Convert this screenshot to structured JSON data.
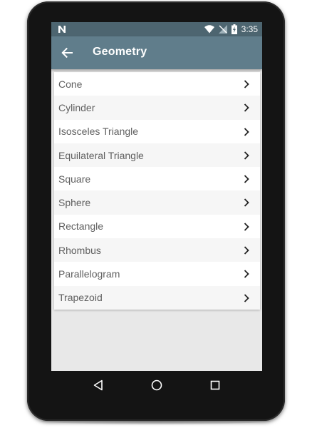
{
  "status_bar": {
    "time": "3:35",
    "icons": [
      "notification-n-icon",
      "wifi-icon",
      "no-signal-icon",
      "battery-charging-icon"
    ]
  },
  "app_bar": {
    "back_icon": "arrow-left-icon",
    "title": "Geometry"
  },
  "shapes": [
    {
      "label": "Cone"
    },
    {
      "label": "Cylinder"
    },
    {
      "label": "Isosceles Triangle"
    },
    {
      "label": "Equilateral Triangle"
    },
    {
      "label": "Square"
    },
    {
      "label": "Sphere"
    },
    {
      "label": "Rectangle"
    },
    {
      "label": "Rhombus"
    },
    {
      "label": "Parallelogram"
    },
    {
      "label": "Trapezoid"
    }
  ],
  "nav_bar": {
    "icons": [
      "nav-back-icon",
      "nav-home-icon",
      "nav-recents-icon"
    ]
  },
  "colors": {
    "status_bar": "#4d6570",
    "app_bar": "#607d8b",
    "screen_bg": "#e8e8e8",
    "item_text": "#5f5f5f"
  }
}
